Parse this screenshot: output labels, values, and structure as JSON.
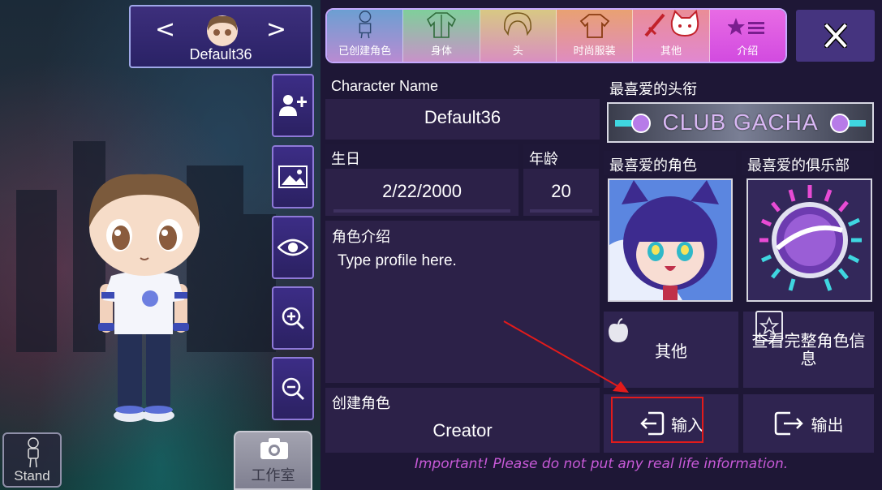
{
  "character": {
    "card_name": "Default36",
    "prev_symbol": "<·",
    "next_symbol": "·>"
  },
  "left_panel": {
    "stand_label": "Stand",
    "studio_label": "工作室",
    "side_buttons": [
      "add-user-icon",
      "image-icon",
      "eye-icon",
      "zoom-in-icon",
      "zoom-out-icon"
    ]
  },
  "tabs": [
    {
      "label": "已创建角色",
      "icon": "person-outline-icon",
      "color": "#7fb3d6"
    },
    {
      "label": "身体",
      "icon": "shirt-body-icon",
      "color": "#8fd39c"
    },
    {
      "label": "头",
      "icon": "hair-icon",
      "color": "#d9c883"
    },
    {
      "label": "时尚服装",
      "icon": "tshirt-icon",
      "color": "#e6a06f"
    },
    {
      "label": "其他",
      "icon": "sword-cat-icon",
      "color": "#e98c9b"
    },
    {
      "label": "介绍",
      "icon": "star-list-icon",
      "color": "#e45ee8",
      "active": true
    }
  ],
  "profile": {
    "name_label": "Character Name",
    "name_value": "Default36",
    "birthday_label": "生日",
    "birthday_value": "2/22/2000",
    "age_label": "年龄",
    "age_value": "20",
    "intro_label": "角色介绍",
    "intro_placeholder": "Type profile here.",
    "creator_label": "创建角色",
    "creator_value": "Creator"
  },
  "favorites": {
    "title_label": "最喜爱的头衔",
    "title_value": "CLUB GACHA",
    "character_label": "最喜爱的角色",
    "club_label": "最喜爱的俱乐部"
  },
  "actions": {
    "other": "其他",
    "view_full": "查看完整角色信息",
    "import": "输入",
    "export": "输出"
  },
  "notice": "Important! Please do not put any real life information.",
  "colors": {
    "panel_bg": "#1e1736",
    "box_bg": "#2c2148",
    "accent_pink": "#e45ee8",
    "notice": "#c85ad8",
    "highlight_red": "#e31b1b"
  }
}
